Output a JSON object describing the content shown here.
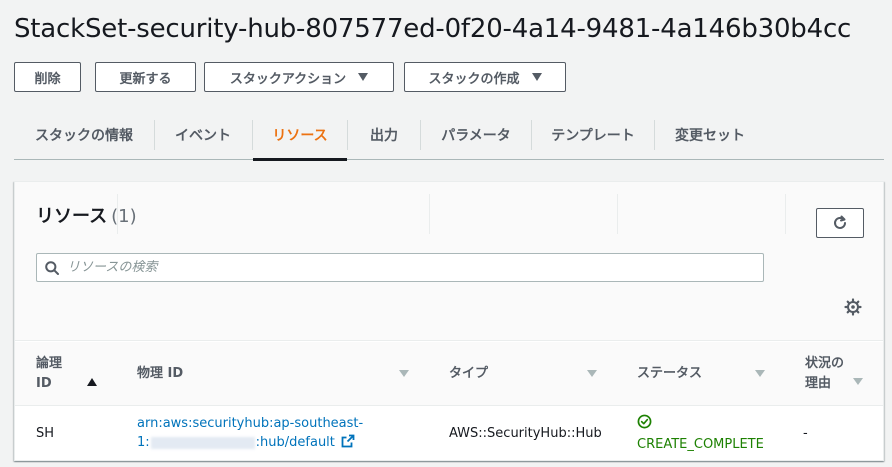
{
  "page": {
    "title": "StackSet-security-hub-807577ed-0f20-4a14-9481-4a146b30b4cc"
  },
  "actions": {
    "delete_label": "削除",
    "update_label": "更新する",
    "stack_actions_label": "スタックアクション",
    "create_stack_label": "スタックの作成"
  },
  "tabs": [
    {
      "label": "スタックの情報"
    },
    {
      "label": "イベント"
    },
    {
      "label": "リソース"
    },
    {
      "label": "出力"
    },
    {
      "label": "パラメータ"
    },
    {
      "label": "テンプレート"
    },
    {
      "label": "変更セット"
    }
  ],
  "active_tab": "リソース",
  "resources": {
    "title": "リソース",
    "count": "(1)",
    "search_placeholder": "リソースの検索",
    "columns": {
      "logical_id_line1": "論理",
      "logical_id_line2": "ID",
      "physical_id": "物理 ID",
      "type": "タイプ",
      "status": "ステータス",
      "reason_line1": "状況の",
      "reason_line2": "理由"
    },
    "rows": [
      {
        "logical_id": "SH",
        "physical_id_line1": "arn:aws:securityhub:ap-southeast-",
        "physical_id_prefix": "1:",
        "physical_id_suffix": ":hub/default",
        "type": "AWS::SecurityHub::Hub",
        "status": "CREATE_COMPLETE",
        "reason": "-"
      }
    ]
  },
  "colors": {
    "accent": "#ec7211",
    "link": "#0073bb",
    "success": "#1d8102"
  },
  "icons": {
    "refresh": "refresh-icon",
    "search": "search-icon",
    "settings": "gear-icon",
    "external": "external-link-icon",
    "status": "check-circle-icon"
  }
}
